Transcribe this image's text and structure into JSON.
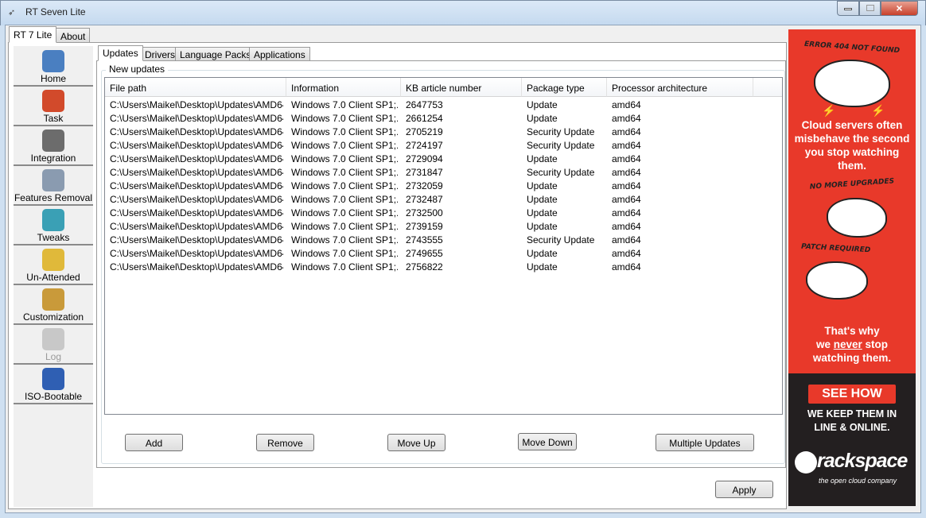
{
  "window": {
    "title": "RT Seven Lite",
    "minimize": "minimize",
    "maximize": "maximize",
    "close": "×"
  },
  "outer_tabs": [
    {
      "label": "RT 7 Lite"
    },
    {
      "label": "About"
    }
  ],
  "sidebar": {
    "items": [
      {
        "label": "Home",
        "icon": "home-icon",
        "color": "#4a7fc1"
      },
      {
        "label": "Task",
        "icon": "task-clipboard-icon",
        "color": "#d24a2b"
      },
      {
        "label": "Integration",
        "icon": "integration-disc-icon",
        "color": "#6c6c6c"
      },
      {
        "label": "Features Removal",
        "icon": "features-removal-icon",
        "color": "#8a9bb0"
      },
      {
        "label": "Tweaks",
        "icon": "tweaks-icon",
        "color": "#3aa0b5"
      },
      {
        "label": "Un-Attended",
        "icon": "unattended-icon",
        "color": "#e0b93a"
      },
      {
        "label": "Customization",
        "icon": "customization-icon",
        "color": "#c99a3a"
      },
      {
        "label": "Log",
        "icon": "log-icon",
        "color": "#c8c8c8",
        "disabled": true
      },
      {
        "label": "ISO-Bootable",
        "icon": "iso-disc-icon",
        "color": "#2f5fb3"
      }
    ]
  },
  "inner_tabs": [
    {
      "label": "Updates"
    },
    {
      "label": "Drivers"
    },
    {
      "label": "Language Packs"
    },
    {
      "label": "Applications"
    }
  ],
  "group_title": "New updates",
  "table": {
    "columns": [
      "File path",
      "Information",
      "KB article number",
      "Package type",
      "Processor architecture"
    ],
    "rows": [
      [
        "C:\\Users\\Maikel\\Desktop\\Updates\\AMD64...",
        "Windows 7.0 Client SP1;...",
        "2647753",
        "Update",
        "amd64"
      ],
      [
        "C:\\Users\\Maikel\\Desktop\\Updates\\AMD64...",
        "Windows 7.0 Client SP1;...",
        "2661254",
        "Update",
        "amd64"
      ],
      [
        "C:\\Users\\Maikel\\Desktop\\Updates\\AMD64...",
        "Windows 7.0 Client SP1;...",
        "2705219",
        "Security Update",
        "amd64"
      ],
      [
        "C:\\Users\\Maikel\\Desktop\\Updates\\AMD64...",
        "Windows 7.0 Client SP1;...",
        "2724197",
        "Security Update",
        "amd64"
      ],
      [
        "C:\\Users\\Maikel\\Desktop\\Updates\\AMD64...",
        "Windows 7.0 Client SP1;...",
        "2729094",
        "Update",
        "amd64"
      ],
      [
        "C:\\Users\\Maikel\\Desktop\\Updates\\AMD64...",
        "Windows 7.0 Client SP1;...",
        "2731847",
        "Security Update",
        "amd64"
      ],
      [
        "C:\\Users\\Maikel\\Desktop\\Updates\\AMD64...",
        "Windows 7.0 Client SP1;...",
        "2732059",
        "Update",
        "amd64"
      ],
      [
        "C:\\Users\\Maikel\\Desktop\\Updates\\AMD64...",
        "Windows 7.0 Client SP1;...",
        "2732487",
        "Update",
        "amd64"
      ],
      [
        "C:\\Users\\Maikel\\Desktop\\Updates\\AMD64...",
        "Windows 7.0 Client SP1;...",
        "2732500",
        "Update",
        "amd64"
      ],
      [
        "C:\\Users\\Maikel\\Desktop\\Updates\\AMD64...",
        "Windows 7.0 Client SP1;...",
        "2739159",
        "Update",
        "amd64"
      ],
      [
        "C:\\Users\\Maikel\\Desktop\\Updates\\AMD64...",
        "Windows 7.0 Client SP1;...",
        "2743555",
        "Security Update",
        "amd64"
      ],
      [
        "C:\\Users\\Maikel\\Desktop\\Updates\\AMD64...",
        "Windows 7.0 Client SP1;...",
        "2749655",
        "Update",
        "amd64"
      ],
      [
        "C:\\Users\\Maikel\\Desktop\\Updates\\AMD64...",
        "Windows 7.0 Client SP1;...",
        "2756822",
        "Update",
        "amd64"
      ]
    ]
  },
  "buttons": {
    "add": "Add",
    "remove": "Remove",
    "move_up": "Move Up",
    "move_down": "Move Down",
    "multiple": "Multiple Updates",
    "apply": "Apply"
  },
  "ad": {
    "caption1": "ERROR 404 NOT FOUND",
    "text1": "Cloud servers often misbehave the second you stop watching them.",
    "caption2": "NO MORE UPGRADES",
    "caption3": "PATCH REQUIRED",
    "text2a": "That's why",
    "text2b_pre": "we ",
    "text2b_em": "never",
    "text2b_post": " stop",
    "text2c": "watching them.",
    "cta": "SEE HOW",
    "text3": "WE KEEP THEM IN LINE & ONLINE.",
    "brand": "rackspace",
    "tagline": "the open cloud company",
    "red": "#e8392a",
    "dark": "#231f20"
  }
}
